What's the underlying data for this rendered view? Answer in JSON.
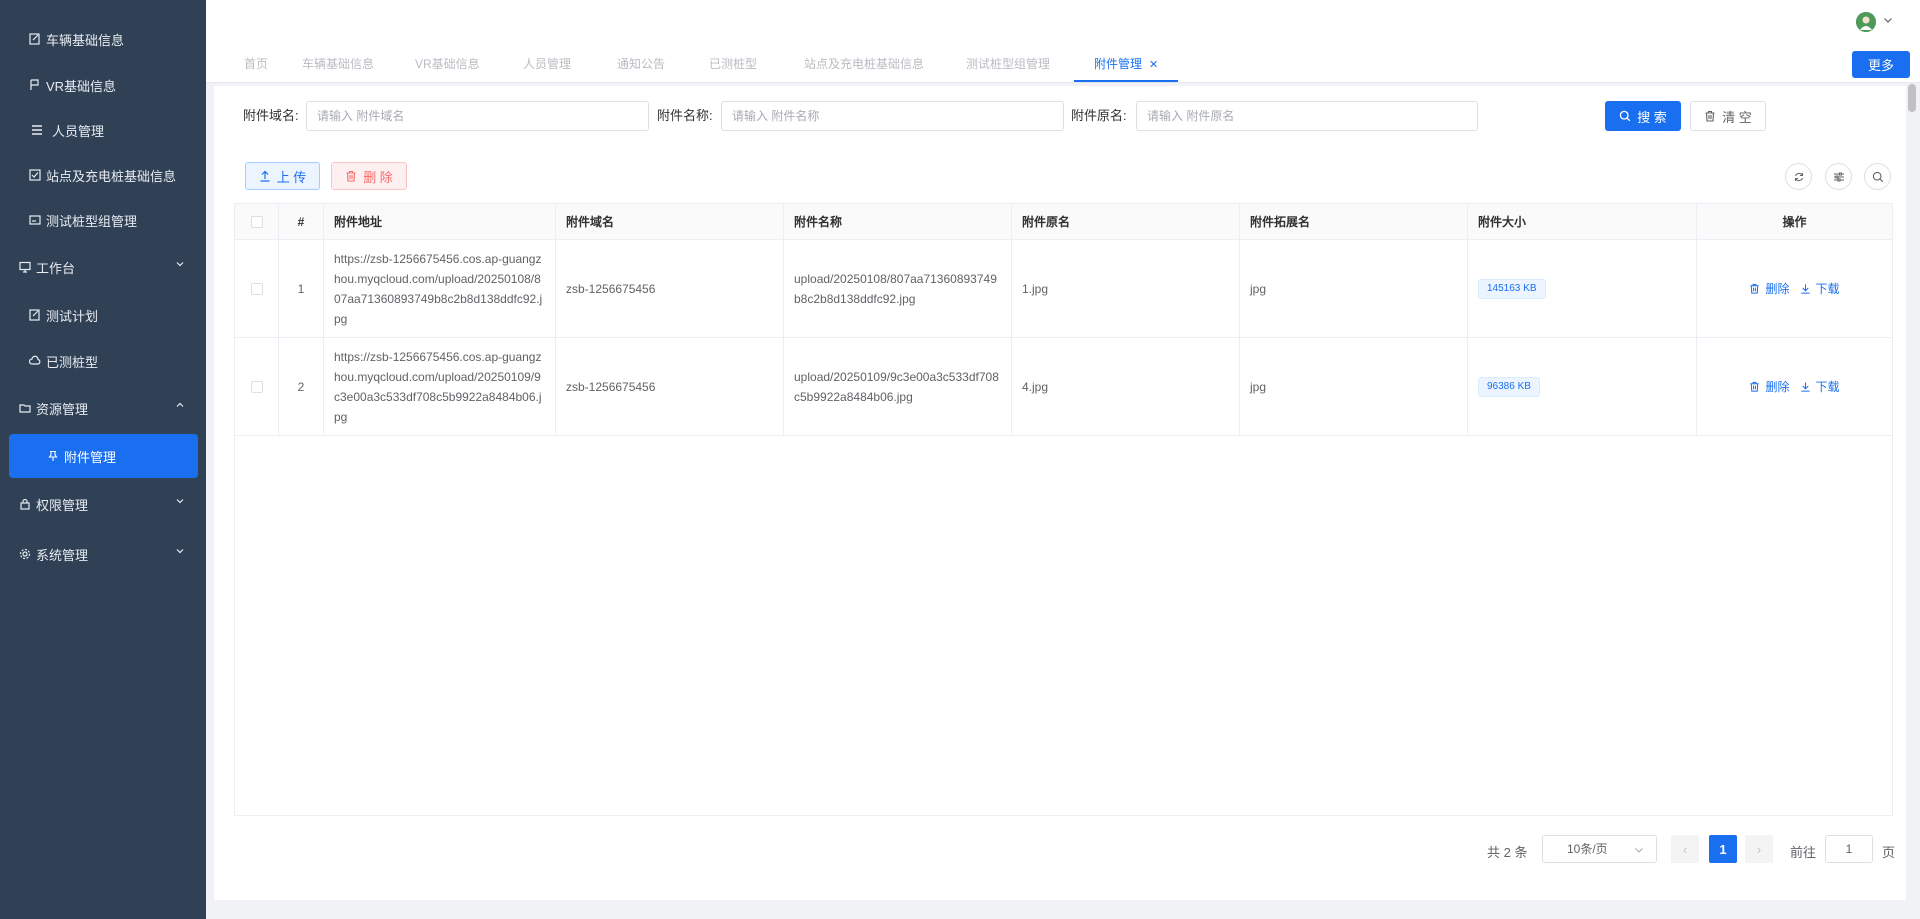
{
  "sidebar": {
    "items": [
      {
        "label": "车辆基础信息",
        "icon": "edit-doc-icon"
      },
      {
        "label": "VR基础信息",
        "icon": "flag-icon"
      },
      {
        "label": "人员管理",
        "icon": "list-icon"
      },
      {
        "label": "站点及充电桩基础信息",
        "icon": "checkbox-icon"
      },
      {
        "label": "测试桩型组管理",
        "icon": "monitor-card-icon"
      },
      {
        "label": "工作台",
        "icon": "monitor-icon"
      },
      {
        "label": "测试计划",
        "icon": "edit-doc-icon"
      },
      {
        "label": "已测桩型",
        "icon": "cloud-icon"
      },
      {
        "label": "资源管理",
        "icon": "folder-icon"
      },
      {
        "label": "附件管理",
        "icon": "pin-icon"
      },
      {
        "label": "权限管理",
        "icon": "lock-icon"
      },
      {
        "label": "系统管理",
        "icon": "gear-icon"
      }
    ]
  },
  "tabs": [
    {
      "label": "首页"
    },
    {
      "label": "车辆基础信息"
    },
    {
      "label": "VR基础信息"
    },
    {
      "label": "人员管理"
    },
    {
      "label": "通知公告"
    },
    {
      "label": "已测桩型"
    },
    {
      "label": "站点及充电桩基础信息"
    },
    {
      "label": "测试桩型组管理"
    },
    {
      "label": "附件管理",
      "close": "✕"
    }
  ],
  "header": {
    "more_label": "更多"
  },
  "filters": {
    "domain_label": "附件域名:",
    "domain_placeholder": "请输入 附件域名",
    "name_label": "附件名称:",
    "name_placeholder": "请输入 附件名称",
    "original_label": "附件原名:",
    "original_placeholder": "请输入 附件原名",
    "search_label": "搜 索",
    "clear_label": "清 空"
  },
  "actions": {
    "upload_label": "上 传",
    "delete_label": "删 除"
  },
  "table": {
    "headers": [
      "#",
      "附件地址",
      "附件域名",
      "附件名称",
      "附件原名",
      "附件拓展名",
      "附件大小",
      "操作"
    ],
    "rows": [
      {
        "index": "1",
        "url": "https://zsb-1256675456.cos.ap-guangzhou.myqcloud.com/upload/20250108/807aa71360893749b8c2b8d138ddfc92.jpg",
        "domain": "zsb-1256675456",
        "name": "upload/20250108/807aa71360893749b8c2b8d138ddfc92.jpg",
        "original": "1.jpg",
        "ext": "jpg",
        "size": "145163 KB",
        "op_delete": "删除",
        "op_download": "下载"
      },
      {
        "index": "2",
        "url": "https://zsb-1256675456.cos.ap-guangzhou.myqcloud.com/upload/20250109/9c3e00a3c533df708c5b9922a8484b06.jpg",
        "domain": "zsb-1256675456",
        "name": "upload/20250109/9c3e00a3c533df708c5b9922a8484b06.jpg",
        "original": "4.jpg",
        "ext": "jpg",
        "size": "96386 KB",
        "op_delete": "删除",
        "op_download": "下载"
      }
    ]
  },
  "pagination": {
    "total": "共 2 条",
    "page_size": "10条/页",
    "current": "1",
    "goto_label": "前往",
    "goto_value": "1",
    "page_suffix": "页",
    "prev": "‹",
    "next": "›"
  },
  "colors": {
    "primary": "#1a6ff0",
    "sidebar": "#304156",
    "danger": "#f56c6c"
  }
}
